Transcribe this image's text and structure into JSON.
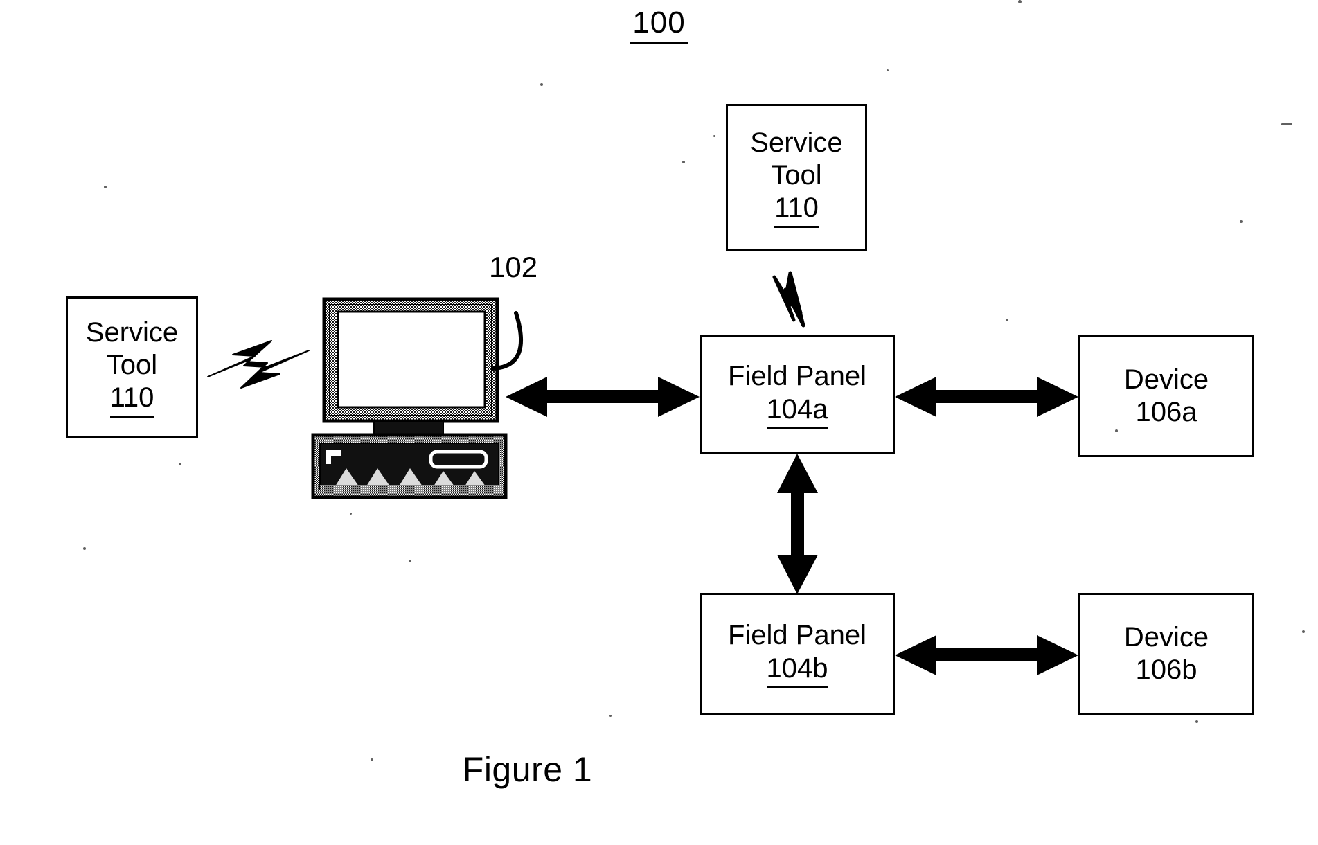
{
  "figure": {
    "reference_numeral": "100",
    "caption": "Figure 1",
    "workstation_numeral": "102"
  },
  "nodes": {
    "service_tool_top": {
      "line1": "Service",
      "line2": "Tool",
      "numeral": "110",
      "numeral_underlined": true
    },
    "service_tool_left": {
      "line1": "Service",
      "line2": "Tool",
      "numeral": "110",
      "numeral_underlined": true
    },
    "field_panel_a": {
      "line1": "Field Panel",
      "numeral": "104a",
      "numeral_underlined": true
    },
    "field_panel_b": {
      "line1": "Field Panel",
      "numeral": "104b",
      "numeral_underlined": true
    },
    "device_a": {
      "line1": "Device",
      "numeral": "106a",
      "numeral_underlined": false
    },
    "device_b": {
      "line1": "Device",
      "numeral": "106b",
      "numeral_underlined": false
    },
    "workstation": {
      "icon": "desktop-computer-icon",
      "numeral": "102"
    }
  },
  "connections": [
    {
      "name": "workstation-to-field-panel-a",
      "style": "double-arrow",
      "orientation": "horizontal"
    },
    {
      "name": "field-panel-a-to-device-a",
      "style": "double-arrow",
      "orientation": "horizontal"
    },
    {
      "name": "field-panel-a-to-field-panel-b",
      "style": "double-arrow",
      "orientation": "vertical"
    },
    {
      "name": "field-panel-b-to-device-b",
      "style": "double-arrow",
      "orientation": "horizontal"
    },
    {
      "name": "service-tool-left-to-workstation",
      "style": "wireless-bolt",
      "orientation": "horizontal"
    },
    {
      "name": "service-tool-top-to-field-panel-a",
      "style": "wireless-bolt",
      "orientation": "vertical"
    }
  ],
  "colors": {
    "ink": "#000000",
    "paper": "#ffffff",
    "screen_fill": "#ffffff",
    "chassis_shade": "#6f6f6f"
  }
}
